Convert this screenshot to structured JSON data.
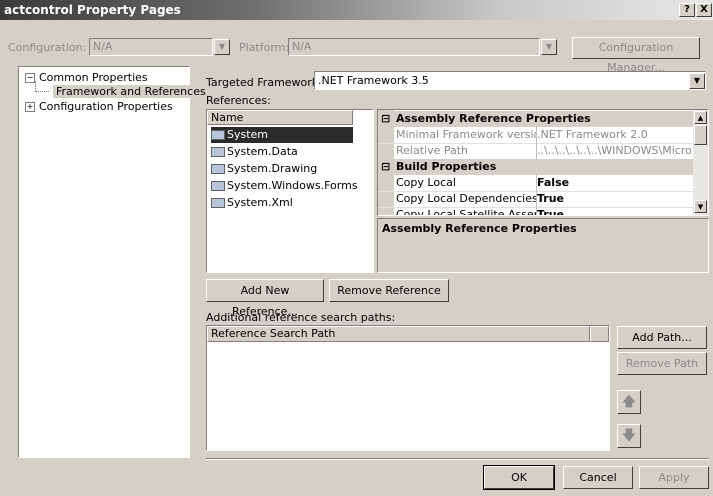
{
  "window": {
    "title": "actcontrol Property Pages",
    "help_label": "?",
    "close_label": "X"
  },
  "config_bar": {
    "configuration_label": "Configuration:",
    "configuration_value": "N/A",
    "platform_label": "Platform:",
    "platform_value": "N/A",
    "config_manager_label": "Configuration Manager..."
  },
  "tree": {
    "items": [
      {
        "label": "Common Properties",
        "expander": "−"
      },
      {
        "label": "Framework and References"
      },
      {
        "label": "Configuration Properties",
        "expander": "+"
      }
    ]
  },
  "framework": {
    "label": "Targeted Framework:",
    "value": ".NET Framework 3.5"
  },
  "references": {
    "label": "References:",
    "column_name": "Name",
    "items": [
      "System",
      "System.Data",
      "System.Drawing",
      "System.Windows.Forms",
      "System.Xml"
    ]
  },
  "properties": {
    "categories": [
      {
        "label": "Assembly Reference Properties",
        "toggle": "⊟"
      },
      {
        "label": "Build Properties",
        "toggle": "⊟"
      }
    ],
    "rows": [
      {
        "name": "Minimal Framework version",
        "value": ".NET Framework 2.0"
      },
      {
        "name": "Relative Path",
        "value": "..\\..\\..\\..\\..\\..\\WINDOWS\\Micro"
      },
      {
        "name": "Copy Local",
        "value": "False"
      },
      {
        "name": "Copy Local Dependencies",
        "value": "True"
      },
      {
        "name": "Copy Local Satellite Assemblies",
        "value": "True"
      }
    ],
    "description_title": "Assembly Reference Properties"
  },
  "ref_buttons": {
    "add_new": "Add New Reference...",
    "remove": "Remove Reference"
  },
  "search_paths": {
    "label": "Additional reference search paths:",
    "column": "Reference Search Path",
    "add_path": "Add Path...",
    "remove_path": "Remove Path"
  },
  "footer": {
    "ok": "OK",
    "cancel": "Cancel",
    "apply": "Apply"
  }
}
